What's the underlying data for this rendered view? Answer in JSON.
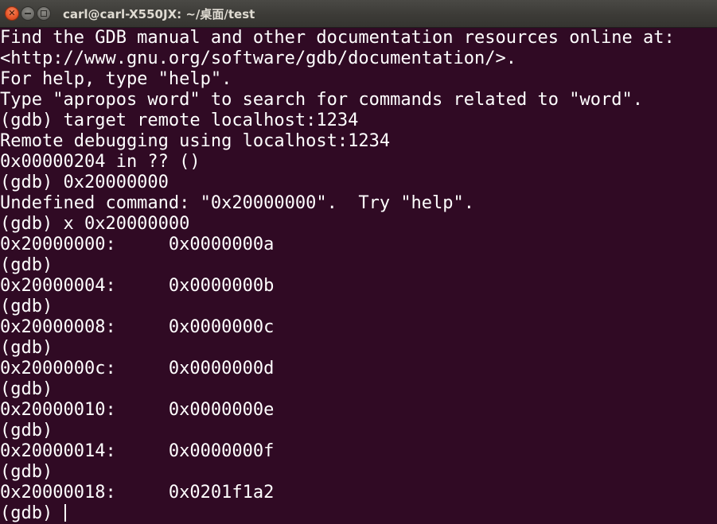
{
  "window": {
    "title": "carl@carl-X550JX: ~/桌面/test",
    "buttons": {
      "close_icon": "close-icon",
      "minimize_icon": "minimize-icon",
      "maximize_icon": "maximize-icon"
    }
  },
  "terminal": {
    "background": "#300a24",
    "foreground": "#ffffff",
    "lines": [
      "Find the GDB manual and other documentation resources online at:",
      "<http://www.gnu.org/software/gdb/documentation/>.",
      "For help, type \"help\".",
      "Type \"apropos word\" to search for commands related to \"word\".",
      "(gdb) target remote localhost:1234",
      "Remote debugging using localhost:1234",
      "0x00000204 in ?? ()",
      "(gdb) 0x20000000",
      "Undefined command: \"0x20000000\".  Try \"help\".",
      "(gdb) x 0x20000000",
      "0x20000000:     0x0000000a",
      "(gdb)",
      "0x20000004:     0x0000000b",
      "(gdb)",
      "0x20000008:     0x0000000c",
      "(gdb)",
      "0x2000000c:     0x0000000d",
      "(gdb)",
      "0x20000010:     0x0000000e",
      "(gdb)",
      "0x20000014:     0x0000000f",
      "(gdb)",
      "0x20000018:     0x0201f1a2"
    ],
    "prompt": "(gdb) "
  }
}
